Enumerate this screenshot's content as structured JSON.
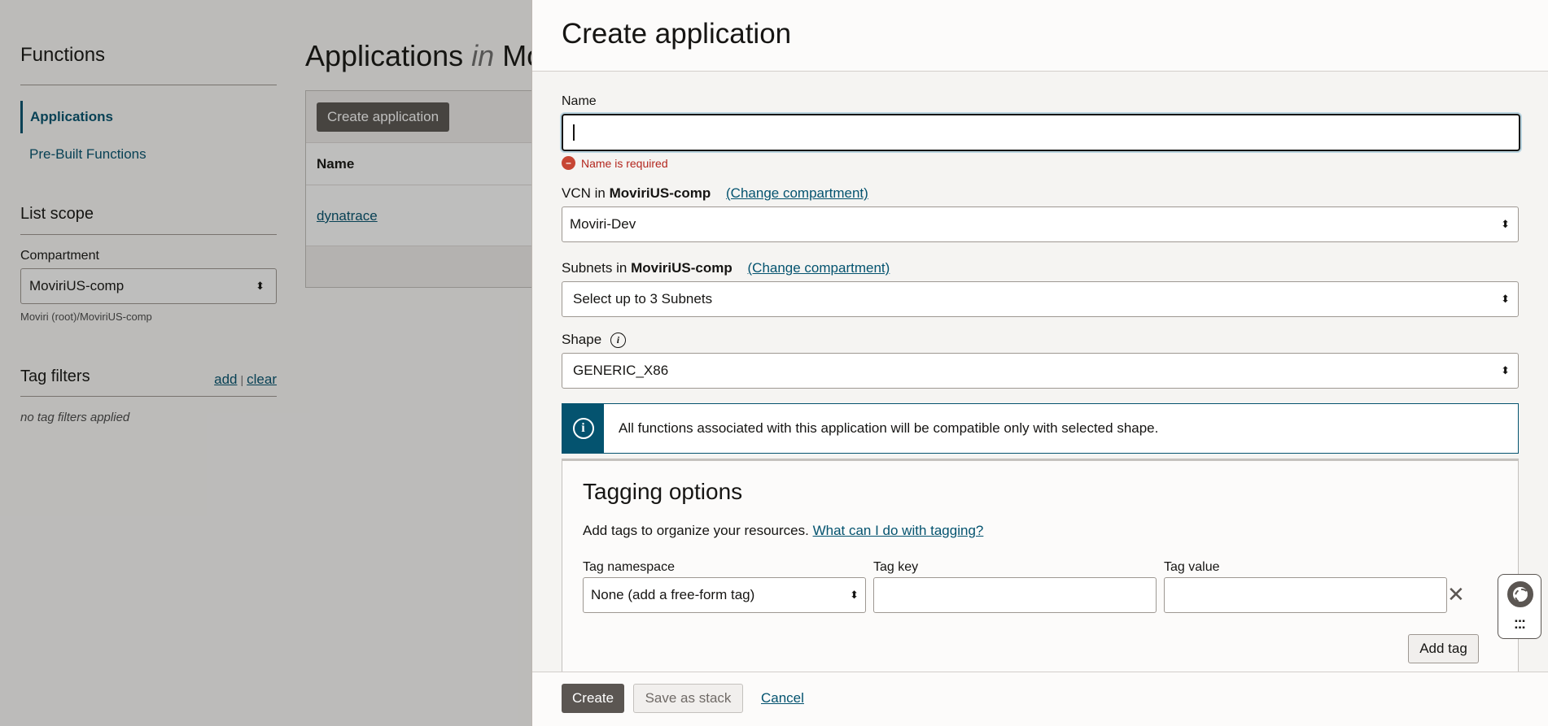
{
  "background": {
    "nav": {
      "title": "Functions",
      "items": [
        {
          "label": "Applications",
          "active": true
        },
        {
          "label": "Pre-Built Functions",
          "active": false
        }
      ],
      "list_scope_title": "List scope",
      "compartment_label": "Compartment",
      "compartment_value": "MoviriUS-comp",
      "compartment_path": "Moviri (root)/MoviriUS-comp",
      "tag_filters_title": "Tag filters",
      "tag_add": "add",
      "tag_sep": "|",
      "tag_clear": "clear",
      "tag_empty": "no tag filters applied"
    },
    "main": {
      "title_prefix": "Applications",
      "title_in": "in",
      "title_suffix": "Mo",
      "create_button": "Create application",
      "column_name": "Name",
      "rows": [
        "dynatrace"
      ]
    }
  },
  "drawer": {
    "title": "Create application",
    "name_label": "Name",
    "name_value": "",
    "name_error": "Name is required",
    "vcn_label": "VCN in",
    "vcn_compartment": "MoviriUS-comp",
    "vcn_change": "(Change compartment)",
    "vcn_value": "Moviri-Dev",
    "subnets_label": "Subnets in",
    "subnets_compartment": "MoviriUS-comp",
    "subnets_change": "(Change compartment)",
    "subnets_placeholder": "Select up to 3 Subnets",
    "shape_label": "Shape",
    "shape_value": "GENERIC_X86",
    "info_message": "All functions associated with this application will be compatible only with selected shape.",
    "tagging": {
      "title": "Tagging options",
      "description": "Add tags to organize your resources.",
      "help_link": "What can I do with tagging?",
      "namespace_label": "Tag namespace",
      "namespace_value": "None (add a free-form tag)",
      "key_label": "Tag key",
      "key_value": "",
      "value_label": "Tag value",
      "value_value": "",
      "add_tag": "Add tag"
    },
    "footer": {
      "create": "Create",
      "save_stack": "Save as stack",
      "cancel": "Cancel"
    }
  },
  "colors": {
    "accent": "#04536f",
    "primary_button": "#5b5652",
    "error": "#c74634"
  },
  "icons": {
    "select_arrows": "⌃⌄",
    "close": "✕",
    "info": "i",
    "grid": "⠿"
  }
}
